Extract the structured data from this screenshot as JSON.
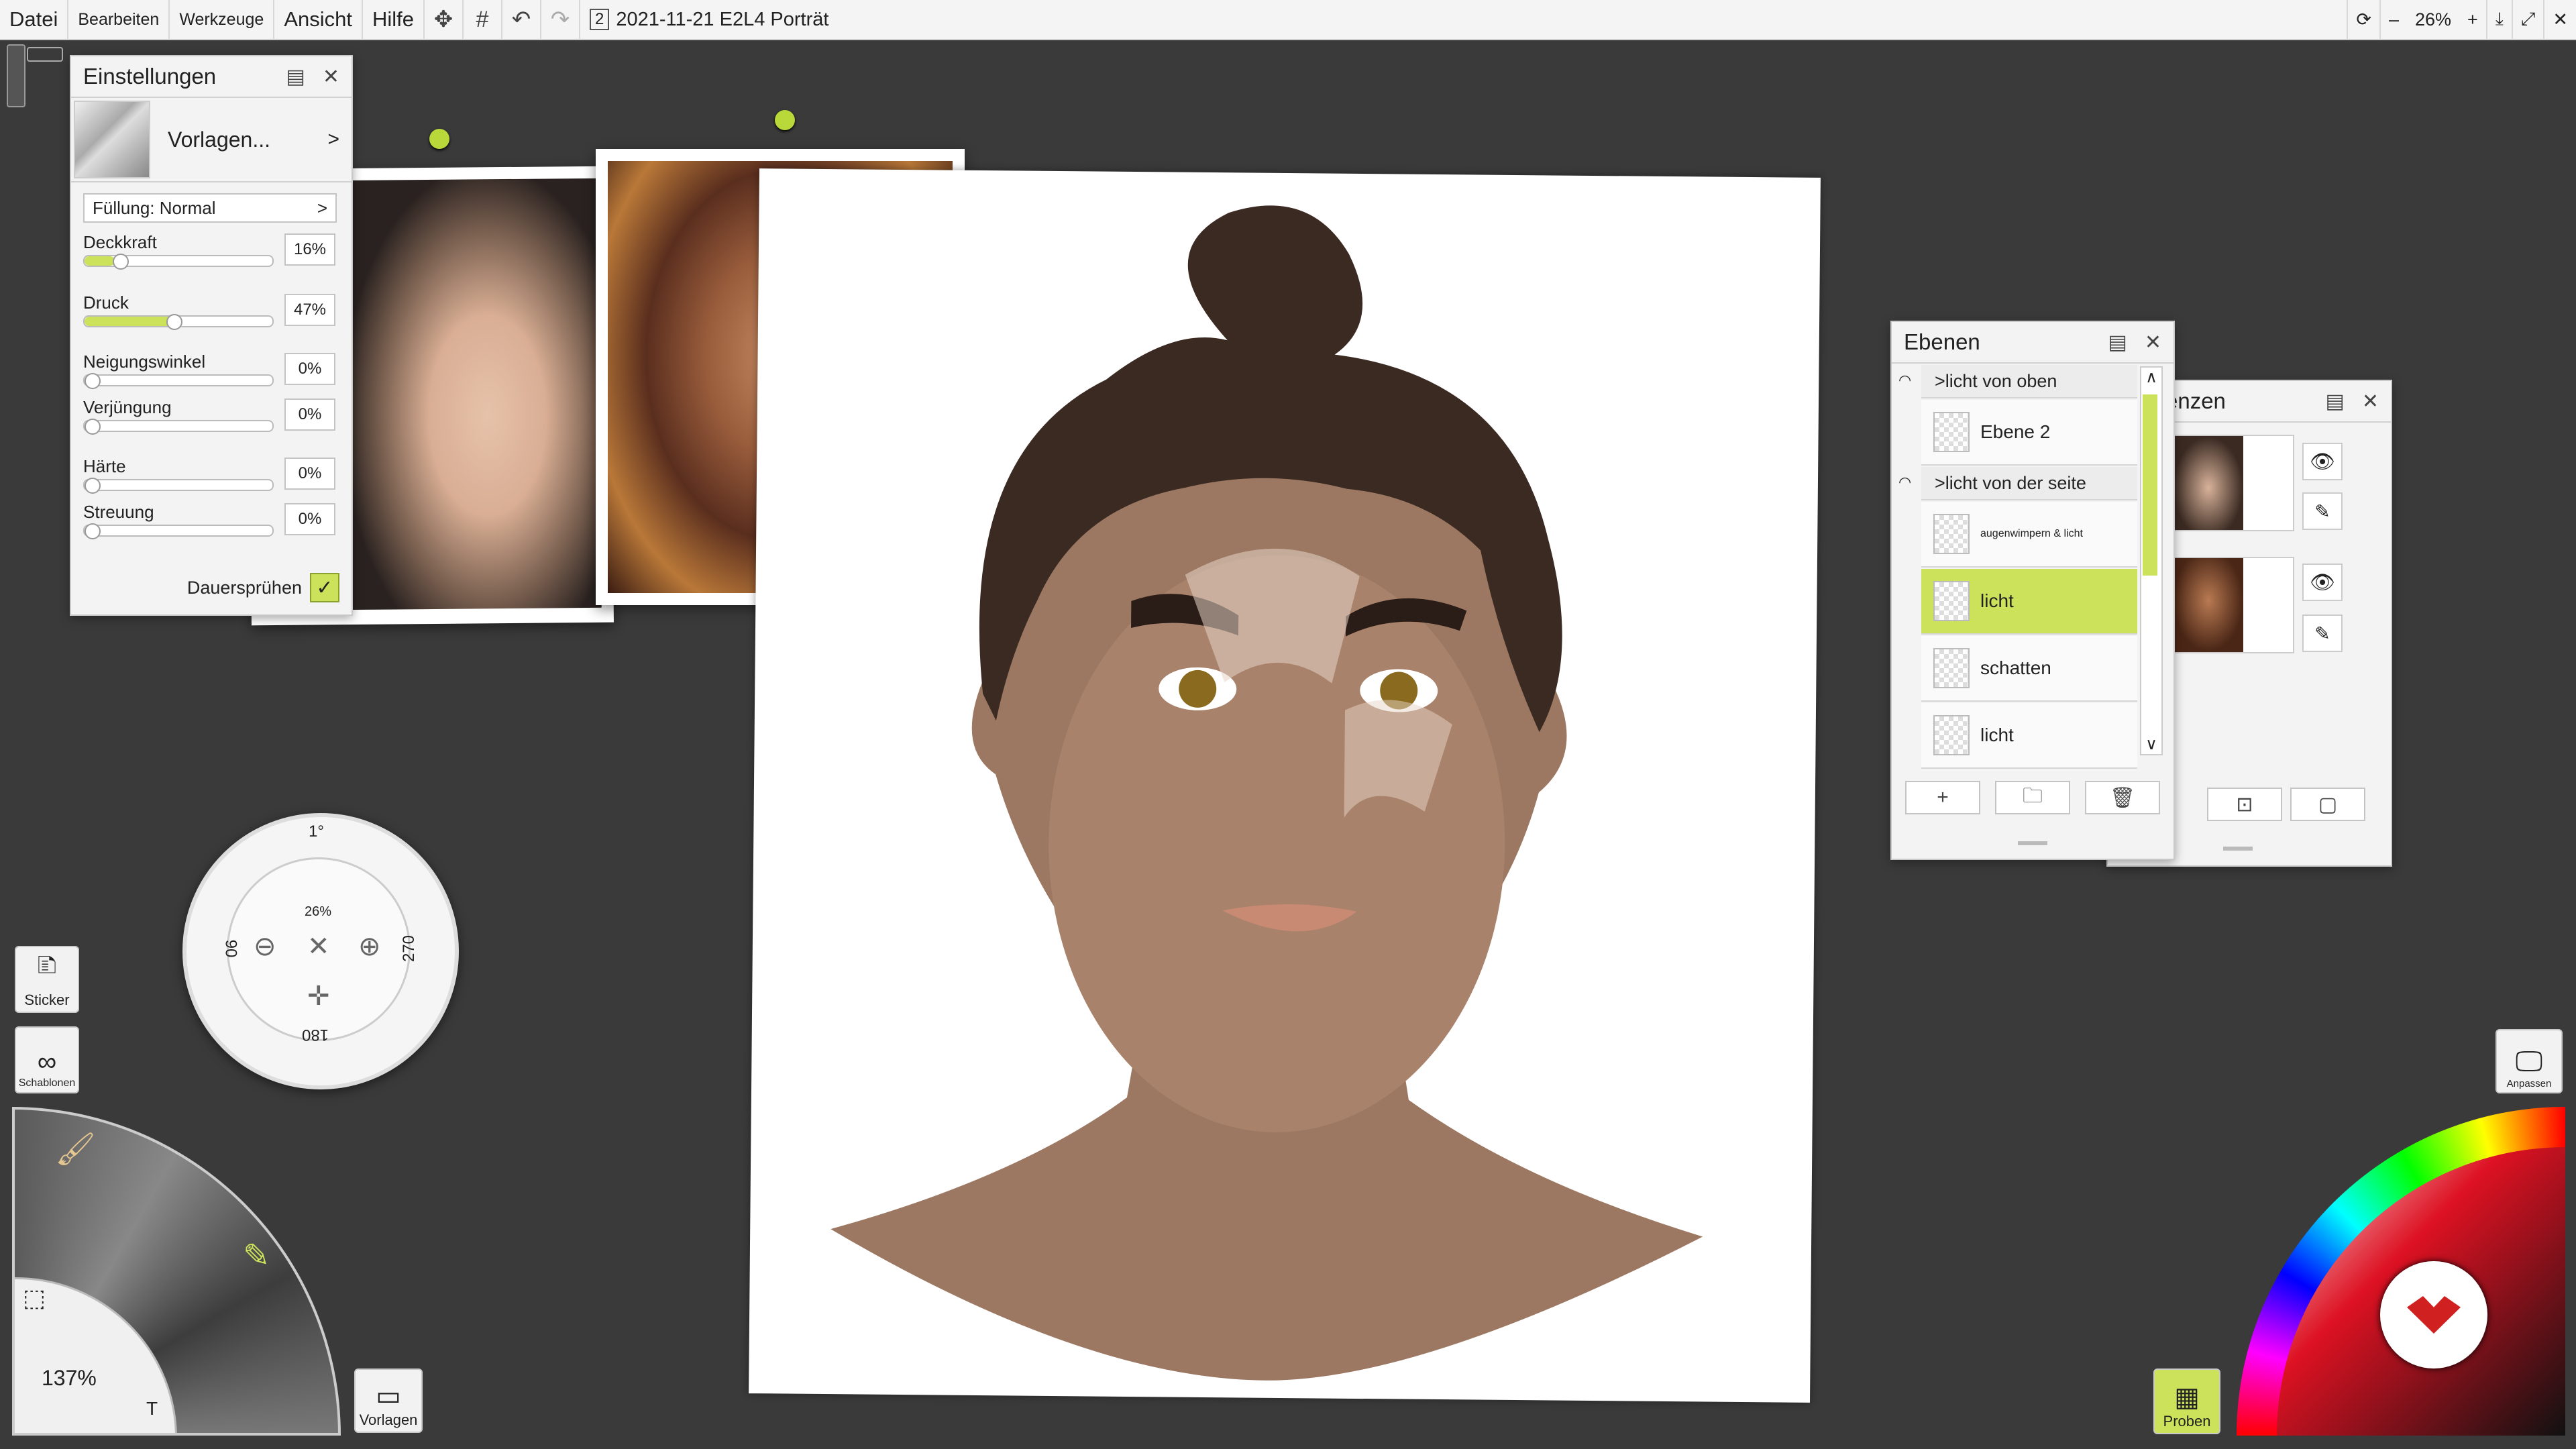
{
  "menu": {
    "file": "Datei",
    "edit": "Bearbeiten",
    "tools": "Werkzeuge",
    "view": "Ansicht",
    "help": "Hilfe"
  },
  "document": {
    "page_badge": "2",
    "title": "2021-11-21 E2L4 Porträt"
  },
  "zoom_bar": {
    "minus": "–",
    "value": "26%",
    "plus": "+"
  },
  "settings": {
    "title": "Einstellungen",
    "presets_label": "Vorlagen...",
    "fill_label": "Füllung: Normal",
    "sliders": [
      {
        "label": "Deckkraft",
        "value": "16%",
        "fraction": 0.16
      },
      {
        "label": "Druck",
        "value": "47%",
        "fraction": 0.47
      },
      {
        "label": "Neigungswinkel",
        "value": "0%",
        "fraction": 0
      },
      {
        "label": "Verjüngung",
        "value": "0%",
        "fraction": 0
      },
      {
        "label": "Härte",
        "value": "0%",
        "fraction": 0
      },
      {
        "label": "Streuung",
        "value": "0%",
        "fraction": 0
      }
    ],
    "continuous_spray_label": "Dauersprühen",
    "continuous_spray_check": "✓"
  },
  "layers": {
    "title": "Ebenen",
    "items": [
      {
        "type": "group",
        "label": ">licht von oben"
      },
      {
        "type": "layer",
        "label": "Ebene 2"
      },
      {
        "type": "group",
        "label": ">licht von der seite"
      },
      {
        "type": "layer",
        "label": "augenwimpern & licht"
      },
      {
        "type": "layer",
        "label": "licht",
        "selected": true
      },
      {
        "type": "layer",
        "label": "schatten"
      },
      {
        "type": "layer",
        "label": "licht"
      }
    ]
  },
  "references": {
    "title_partial": "enzen"
  },
  "navigator": {
    "top": "1°",
    "left": "90",
    "right": "270",
    "bottom": "180",
    "zoom": "26%"
  },
  "toolbar": {
    "sticker": "Sticker",
    "stencils": "Schablonen",
    "presets": "Vorlagen",
    "samples": "Proben",
    "adjust": "Anpassen"
  },
  "tool_wheel": {
    "zoom": "137%",
    "text_tool": "T"
  },
  "colors": {
    "accent": "#cbe25a",
    "panel_bg": "#f3f3f3",
    "bg": "#3a3a3a"
  }
}
